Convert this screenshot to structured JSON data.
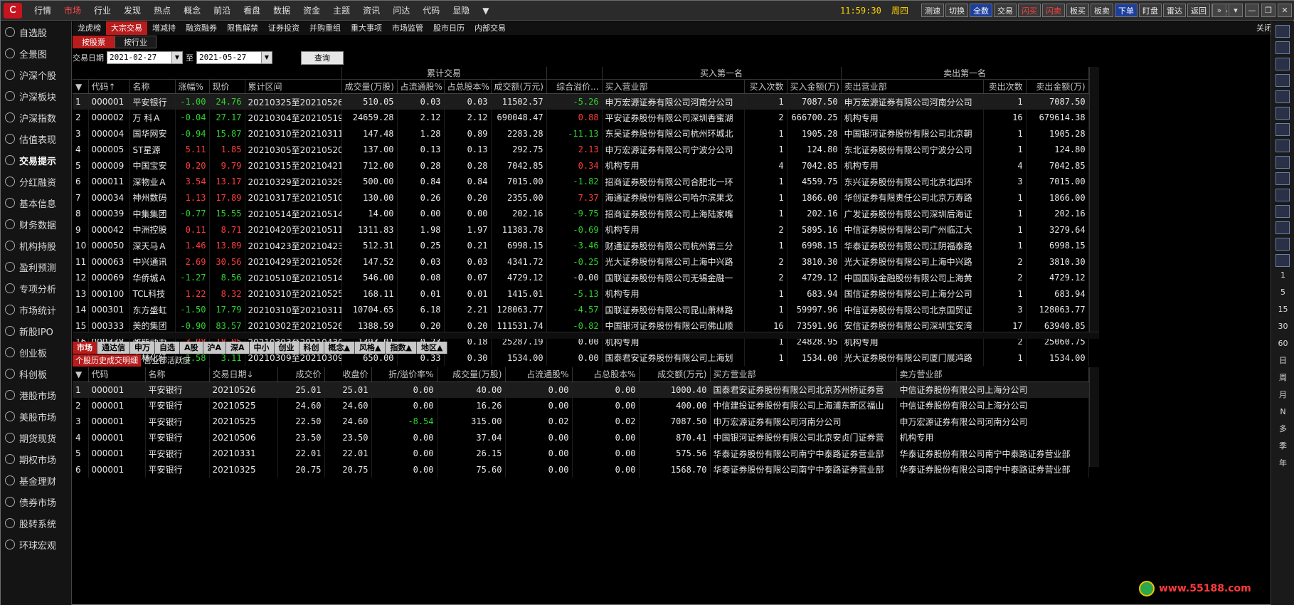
{
  "menubar": {
    "logo_text": "Ｃ",
    "items": [
      "行情",
      "市场",
      "行业",
      "发现",
      "热点",
      "概念",
      "前沿",
      "看盘",
      "数据",
      "资金",
      "主题",
      "资讯",
      "问达",
      "代码",
      "显隐",
      "▼"
    ],
    "active_index": 1,
    "clock": "11:59:30",
    "weekday": "周四",
    "quick_buttons": [
      "测速",
      "切换",
      "全数",
      "交易",
      "闪买",
      "闪卖",
      "板买",
      "板卖",
      "下单",
      "盯盘",
      "雷达",
      "返回",
      ">>>"
    ],
    "quick_button_styles": [
      "n",
      "n",
      "blue",
      "n",
      "red",
      "red",
      "n",
      "n",
      "blue",
      "n",
      "n",
      "n",
      "n"
    ],
    "window_controls": [
      "»",
      "▾",
      "—",
      "❐",
      "✕"
    ]
  },
  "sidebar": {
    "items": [
      "自选股",
      "全景图",
      "沪深个股",
      "沪深板块",
      "沪深指数",
      "估值表现",
      "交易提示",
      "分红融资",
      "基本信息",
      "财务数据",
      "机构持股",
      "盈利预测",
      "专项分析",
      "市场统计",
      "新股IPO",
      "创业板",
      "科创板",
      "港股市场",
      "美股市场",
      "期货现货",
      "期权市场",
      "基金理财",
      "债券市场",
      "股转系统",
      "环球宏观"
    ],
    "active_index": 6
  },
  "subtabs": {
    "items": [
      "龙虎榜",
      "大宗交易",
      "增减持",
      "融资融券",
      "限售解禁",
      "证券投资",
      "并购重组",
      "重大事项",
      "市场监管",
      "股市日历",
      "内部交易"
    ],
    "active_index": 1,
    "close_label": "关闭"
  },
  "modetabs": {
    "items": [
      "按股票",
      "按行业"
    ],
    "active_index": 0
  },
  "filter": {
    "date_label": "交易日期",
    "start_date": "2021-02-27",
    "to_label": "至",
    "end_date": "2021-05-27",
    "query_button": "查询"
  },
  "grid1": {
    "group_headers": {
      "cumulative": "累计交易",
      "buy_first": "买入第一名",
      "sell_first": "卖出第一名"
    },
    "columns": [
      "▼",
      "代码↑",
      "名称",
      "涨幅%",
      "现价",
      "累计区间",
      "成交量(万股)",
      "占流通股%",
      "占总股本%",
      "成交额(万元)",
      "综合溢价...",
      "买入营业部",
      "买入次数",
      "买入金额(万)",
      "卖出营业部",
      "卖出次数",
      "卖出金额(万)"
    ],
    "rows": [
      [
        "1",
        "000001",
        "平安银行",
        "-1.00",
        "24.76",
        "20210325至20210526",
        "510.05",
        "0.03",
        "0.03",
        "11502.57",
        "-5.26",
        "申万宏源证券有限公司河南分公司",
        "1",
        "7087.50",
        "申万宏源证券有限公司河南分公司",
        "1",
        "7087.50"
      ],
      [
        "2",
        "000002",
        "万 科Ａ",
        "-0.04",
        "27.17",
        "20210304至20210519",
        "24659.28",
        "2.12",
        "2.12",
        "690048.47",
        "0.88",
        "平安证券股份有限公司深圳香蜜湖",
        "2",
        "666700.25",
        "机构专用",
        "16",
        "679614.38"
      ],
      [
        "3",
        "000004",
        "国华网安",
        "-0.94",
        "15.87",
        "20210310至20210311",
        "147.48",
        "1.28",
        "0.89",
        "2283.28",
        "-11.13",
        "东吴证券股份有限公司杭州环城北",
        "1",
        "1905.28",
        "中国银河证券股份有限公司北京朝",
        "1",
        "1905.28"
      ],
      [
        "4",
        "000005",
        "ST星源",
        "5.11",
        "1.85",
        "20210305至20210520",
        "137.00",
        "0.13",
        "0.13",
        "292.75",
        "2.13",
        "申万宏源证券有限公司宁波分公司",
        "1",
        "124.80",
        "东北证券股份有限公司宁波分公司",
        "1",
        "124.80"
      ],
      [
        "5",
        "000009",
        "中国宝安",
        "0.20",
        "9.79",
        "20210315至20210421",
        "712.00",
        "0.28",
        "0.28",
        "7042.85",
        "0.34",
        "机构专用",
        "4",
        "7042.85",
        "机构专用",
        "4",
        "7042.85"
      ],
      [
        "6",
        "000011",
        "深物业Ａ",
        "3.54",
        "13.17",
        "20210329至20210329",
        "500.00",
        "0.84",
        "0.84",
        "7015.00",
        "-1.82",
        "招商证券股份有限公司合肥北一环",
        "1",
        "4559.75",
        "东兴证券股份有限公司北京北四环",
        "3",
        "7015.00"
      ],
      [
        "7",
        "000034",
        "神州数码",
        "1.13",
        "17.89",
        "20210317至20210510",
        "130.00",
        "0.26",
        "0.20",
        "2355.00",
        "7.37",
        "海通证券股份有限公司哈尔滨果戈",
        "1",
        "1866.00",
        "华创证券有限责任公司北京万寿路",
        "1",
        "1866.00"
      ],
      [
        "8",
        "000039",
        "中集集团",
        "-0.77",
        "15.55",
        "20210514至20210514",
        "14.00",
        "0.00",
        "0.00",
        "202.16",
        "-9.75",
        "招商证券股份有限公司上海陆家嘴",
        "1",
        "202.16",
        "广发证券股份有限公司深圳后海证",
        "1",
        "202.16"
      ],
      [
        "9",
        "000042",
        "中洲控股",
        "0.11",
        "8.71",
        "20210420至20210511",
        "1311.83",
        "1.98",
        "1.97",
        "11383.78",
        "-0.69",
        "机构专用",
        "2",
        "5895.16",
        "中信证券股份有限公司广州临江大",
        "1",
        "3279.64"
      ],
      [
        "10",
        "000050",
        "深天马Ａ",
        "1.46",
        "13.89",
        "20210423至20210423",
        "512.31",
        "0.25",
        "0.21",
        "6998.15",
        "-3.46",
        "财通证券股份有限公司杭州第三分",
        "1",
        "6998.15",
        "华泰证券股份有限公司江阴福泰路",
        "1",
        "6998.15"
      ],
      [
        "11",
        "000063",
        "中兴通讯",
        "2.69",
        "30.56",
        "20210429至20210526",
        "147.52",
        "0.03",
        "0.03",
        "4341.72",
        "-0.25",
        "光大证券股份有限公司上海中兴路",
        "2",
        "3810.30",
        "光大证券股份有限公司上海中兴路",
        "2",
        "3810.30"
      ],
      [
        "12",
        "000069",
        "华侨城Ａ",
        "-1.27",
        "8.56",
        "20210510至20210514",
        "546.00",
        "0.08",
        "0.07",
        "4729.12",
        "-0.00",
        "国联证券股份有限公司无锡金融一",
        "2",
        "4729.12",
        "中国国际金融股份有限公司上海黄",
        "2",
        "4729.12"
      ],
      [
        "13",
        "000100",
        "TCL科技",
        "1.22",
        "8.32",
        "20210310至20210525",
        "168.11",
        "0.01",
        "0.01",
        "1415.01",
        "-5.13",
        "机构专用",
        "1",
        "683.94",
        "国信证券股份有限公司上海分公司",
        "1",
        "683.94"
      ],
      [
        "14",
        "000301",
        "东方盛虹",
        "-1.50",
        "17.79",
        "20210310至20210311",
        "10704.65",
        "6.18",
        "2.21",
        "128063.77",
        "-4.57",
        "国联证券股份有限公司昆山萧林路",
        "1",
        "59997.96",
        "中信证券股份有限公司北京国贸证",
        "3",
        "128063.77"
      ],
      [
        "15",
        "000333",
        "美的集团",
        "-0.90",
        "83.57",
        "20210302至20210526",
        "1388.59",
        "0.20",
        "0.20",
        "111531.74",
        "-0.82",
        "中国银河证券股份有限公司佛山顺",
        "16",
        "73591.96",
        "安信证券股份有限公司深圳宝安湾",
        "17",
        "63940.85"
      ],
      [
        "16",
        "000338",
        "潍柴动力",
        "3.08",
        "18.05",
        "20210303至20210430",
        "1393.01",
        "0.23",
        "0.18",
        "25287.19",
        "0.00",
        "机构专用",
        "1",
        "24828.95",
        "机构专用",
        "2",
        "25060.75"
      ],
      [
        "17",
        "000420",
        "吉林化纤",
        "-1.58",
        "3.11",
        "20210309至20210309",
        "650.00",
        "0.33",
        "0.30",
        "1534.00",
        "0.00",
        "国泰君安证券股份有限公司上海划",
        "1",
        "1534.00",
        "光大证券股份有限公司厦门展鸿路",
        "1",
        "1534.00"
      ]
    ]
  },
  "bottomtabs": {
    "items": [
      "市场",
      "通达信",
      "申万",
      "自选",
      "A股",
      "沪A",
      "深A",
      "中小",
      "创业",
      "科创",
      "概念▲",
      "风格▲",
      "指数▲",
      "地区▲"
    ],
    "active_index": 0
  },
  "lowertabs": {
    "items": [
      "个股历史成交明细",
      "营业部活跃度"
    ],
    "active_index": 0
  },
  "grid2": {
    "columns": [
      "▼",
      "代码",
      "名称",
      "交易日期↓",
      "成交价",
      "收盘价",
      "折/溢价率%",
      "成交量(万股)",
      "占流通股%",
      "占总股本%",
      "成交额(万元)",
      "买方营业部",
      "卖方营业部"
    ],
    "rows": [
      [
        "1",
        "000001",
        "平安银行",
        "20210526",
        "25.01",
        "25.01",
        "0.00",
        "40.00",
        "0.00",
        "0.00",
        "1000.40",
        "国泰君安证券股份有限公司北京苏州桥证券营",
        "中信证券股份有限公司上海分公司"
      ],
      [
        "2",
        "000001",
        "平安银行",
        "20210525",
        "24.60",
        "24.60",
        "0.00",
        "16.26",
        "0.00",
        "0.00",
        "400.00",
        "中信建投证券股份有限公司上海浦东新区福山",
        "中信证券股份有限公司上海分公司"
      ],
      [
        "3",
        "000001",
        "平安银行",
        "20210525",
        "22.50",
        "24.60",
        "-8.54",
        "315.00",
        "0.02",
        "0.02",
        "7087.50",
        "申万宏源证券有限公司河南分公司",
        "申万宏源证券有限公司河南分公司"
      ],
      [
        "4",
        "000001",
        "平安银行",
        "20210506",
        "23.50",
        "23.50",
        "0.00",
        "37.04",
        "0.00",
        "0.00",
        "870.41",
        "中国银河证券股份有限公司北京安贞门证券营",
        "机构专用"
      ],
      [
        "5",
        "000001",
        "平安银行",
        "20210331",
        "22.01",
        "22.01",
        "0.00",
        "26.15",
        "0.00",
        "0.00",
        "575.56",
        "华泰证券股份有限公司南宁中泰路证券营业部",
        "华泰证券股份有限公司南宁中泰路证券营业部"
      ],
      [
        "6",
        "000001",
        "平安银行",
        "20210325",
        "20.75",
        "20.75",
        "0.00",
        "75.60",
        "0.00",
        "0.00",
        "1568.70",
        "华泰证券股份有限公司南宁中泰路证券营业部",
        "华泰证券股份有限公司南宁中泰路证券营业部"
      ]
    ]
  },
  "righttools": {
    "period_labels": [
      "1",
      "5",
      "15",
      "30",
      "60",
      "日",
      "周",
      "月",
      "N",
      "多",
      "季",
      "年"
    ]
  },
  "watermark": "www.55188.com",
  "colors": {
    "up": "#ff3c3c",
    "down": "#2ed32e",
    "accent": "#b81c1c",
    "clock": "#ffd200"
  }
}
